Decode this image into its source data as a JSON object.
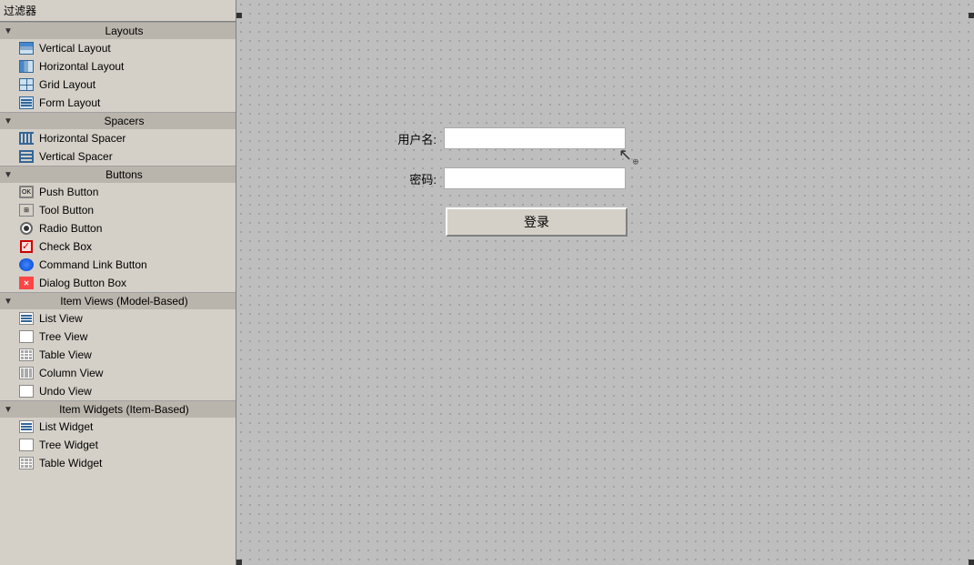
{
  "filter_bar": {
    "label": "过滤器"
  },
  "sections": [
    {
      "id": "layouts",
      "label": "Layouts",
      "items": [
        {
          "id": "vertical-layout",
          "label": "Vertical Layout",
          "icon": "vertical-layout"
        },
        {
          "id": "horizontal-layout",
          "label": "Horizontal Layout",
          "icon": "horizontal-layout"
        },
        {
          "id": "grid-layout",
          "label": "Grid Layout",
          "icon": "grid-layout"
        },
        {
          "id": "form-layout",
          "label": "Form Layout",
          "icon": "form-layout"
        }
      ]
    },
    {
      "id": "spacers",
      "label": "Spacers",
      "items": [
        {
          "id": "horizontal-spacer",
          "label": "Horizontal Spacer",
          "icon": "spacer-h"
        },
        {
          "id": "vertical-spacer",
          "label": "Vertical Spacer",
          "icon": "spacer-v"
        }
      ]
    },
    {
      "id": "buttons",
      "label": "Buttons",
      "items": [
        {
          "id": "push-button",
          "label": "Push Button",
          "icon": "push-button"
        },
        {
          "id": "tool-button",
          "label": "Tool Button",
          "icon": "tool-button"
        },
        {
          "id": "radio-button",
          "label": "Radio Button",
          "icon": "radio"
        },
        {
          "id": "check-box",
          "label": "Check Box",
          "icon": "checkbox"
        },
        {
          "id": "command-link-button",
          "label": "Command Link Button",
          "icon": "command-link"
        },
        {
          "id": "dialog-button-box",
          "label": "Dialog Button Box",
          "icon": "dialog-button"
        }
      ]
    },
    {
      "id": "item-views",
      "label": "Item Views (Model-Based)",
      "items": [
        {
          "id": "list-view",
          "label": "List View",
          "icon": "list-view"
        },
        {
          "id": "tree-view",
          "label": "Tree View",
          "icon": "tree-view"
        },
        {
          "id": "table-view",
          "label": "Table View",
          "icon": "table-view"
        },
        {
          "id": "column-view",
          "label": "Column View",
          "icon": "column-view"
        },
        {
          "id": "undo-view",
          "label": "Undo View",
          "icon": "undo-view"
        }
      ]
    },
    {
      "id": "item-widgets",
      "label": "Item Widgets (Item-Based)",
      "items": [
        {
          "id": "list-widget",
          "label": "List Widget",
          "icon": "list-view"
        },
        {
          "id": "tree-widget",
          "label": "Tree Widget",
          "icon": "tree-view"
        },
        {
          "id": "table-widget",
          "label": "Table Widget",
          "icon": "table-view"
        }
      ]
    }
  ],
  "canvas": {
    "form": {
      "username_label": "用户名:",
      "password_label": "密码:",
      "login_button": "登录",
      "username_placeholder": "",
      "password_placeholder": ""
    }
  }
}
